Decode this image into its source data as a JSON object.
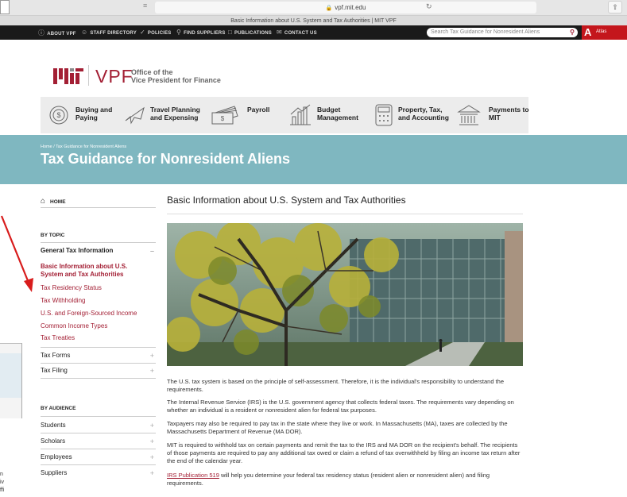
{
  "browser": {
    "url": "vpf.mit.edu",
    "tab_title": "Basic Information about U.S. System and Tax Authorities | MIT VPF"
  },
  "utility_bar": {
    "links": [
      {
        "label": "ABOUT VPF",
        "icon": "info-icon"
      },
      {
        "label": "STAFF DIRECTORY",
        "icon": "person-icon"
      },
      {
        "label": "POLICIES",
        "icon": "check-circle-icon"
      },
      {
        "label": "FIND SUPPLIERS",
        "icon": "search-icon"
      },
      {
        "label": "PUBLICATIONS",
        "icon": "document-icon"
      },
      {
        "label": "CONTACT US",
        "icon": "mail-icon"
      }
    ],
    "search_placeholder": "Search Tax Guidance for Nonresident Aliens",
    "atlas_label": "Atlas"
  },
  "header": {
    "vpf_text": "VPF",
    "office_line1": "Office of the",
    "office_line2": "Vice President for Finance"
  },
  "main_nav": [
    {
      "line1": "Buying and",
      "line2": "Paying",
      "icon": "dollar-coin-icon"
    },
    {
      "line1": "Travel Planning",
      "line2": "and Expensing",
      "icon": "airplane-icon"
    },
    {
      "line1": "Payroll",
      "line2": "",
      "icon": "cash-stack-icon"
    },
    {
      "line1": "Budget",
      "line2": "Management",
      "icon": "bar-chart-icon"
    },
    {
      "line1": "Property, Tax,",
      "line2": "and Accounting",
      "icon": "calculator-icon"
    },
    {
      "line1": "Payments to",
      "line2": "MIT",
      "icon": "building-columns-icon"
    }
  ],
  "hero": {
    "breadcrumb": "Home / Tax Guidance for Nonresident Aliens",
    "title": "Tax Guidance for Nonresident Aliens"
  },
  "sidebar": {
    "home": "HOME",
    "by_topic": "BY TOPIC",
    "general": "General Tax Information",
    "general_links": [
      "Basic Information about U.S.",
      "System and Tax Authorities",
      "Tax Residency Status",
      "Tax Withholding",
      "U.S. and Foreign-Sourced Income",
      "Common Income Types",
      "Tax Treaties"
    ],
    "topic_items": [
      "Tax Forms",
      "Tax Filing"
    ],
    "by_audience": "BY AUDIENCE",
    "audience_items": [
      "Students",
      "Scholars",
      "Employees",
      "Suppliers"
    ]
  },
  "content": {
    "title": "Basic Information about U.S. System and Tax Authorities",
    "p1": "The U.S. tax system is based on the principle of self-assessment. Therefore, it is the individual's responsibility to understand the requirements.",
    "p2": "The Internal Revenue Service (IRS) is the U.S. government agency that collects federal taxes. The requirements vary depending on whether an individual is a resident or nonresident alien for federal tax purposes.",
    "p3": "Taxpayers may also be required to pay tax in the state where they live or work. In Massachusetts (MA), taxes are collected by the Massachusetts Department of Revenue (MA DOR).",
    "p4": "MIT is required to withhold tax on certain payments and remit the tax to the IRS and MA DOR on the recipient's behalf. The recipients of those payments are required to pay any additional tax owed or claim a refund of tax overwithheld by filing an income tax return after the end of the calendar year.",
    "p5_link": "IRS Publication 519",
    "p5_rest": " will help you determine your federal tax residency status (resident alien or nonresident alien) and filing requirements."
  },
  "background_window": {
    "lines": [
      "n",
      "iv",
      "ffi"
    ]
  },
  "colors": {
    "accent": "#a31f34",
    "hero": "#7fb7c0",
    "utility_bar": "#1a1a1a",
    "nav_bg": "#ececec",
    "annotation_arrow": "#d81c1c"
  }
}
